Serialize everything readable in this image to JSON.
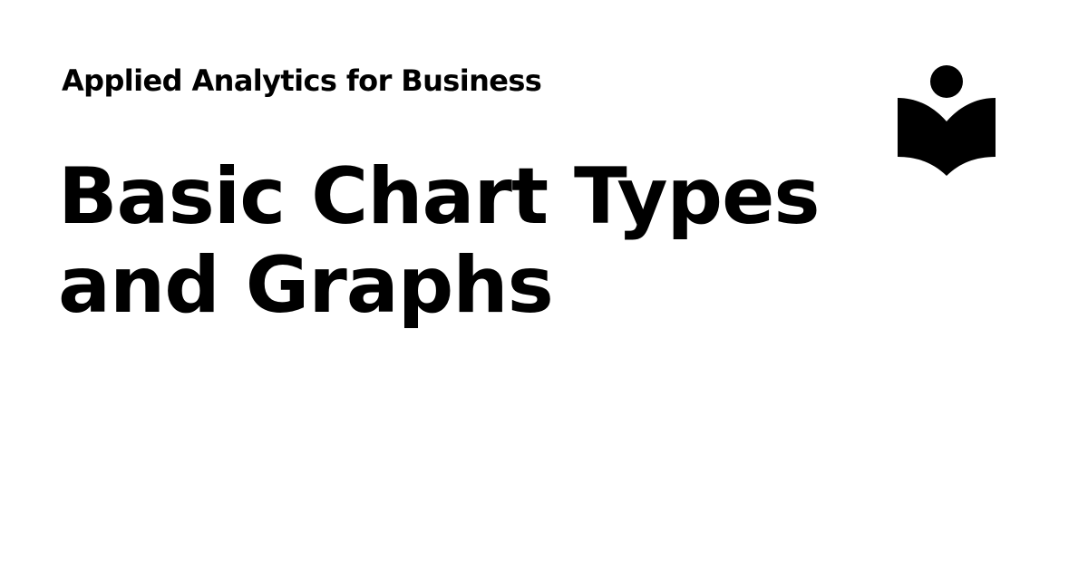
{
  "header": {
    "book_title": "Applied Analytics for Business"
  },
  "main": {
    "title_line_1": "Basic Chart Types",
    "title_line_2": "and Graphs"
  },
  "logo": {
    "icon": "reader-book-icon",
    "color": "#000000"
  }
}
